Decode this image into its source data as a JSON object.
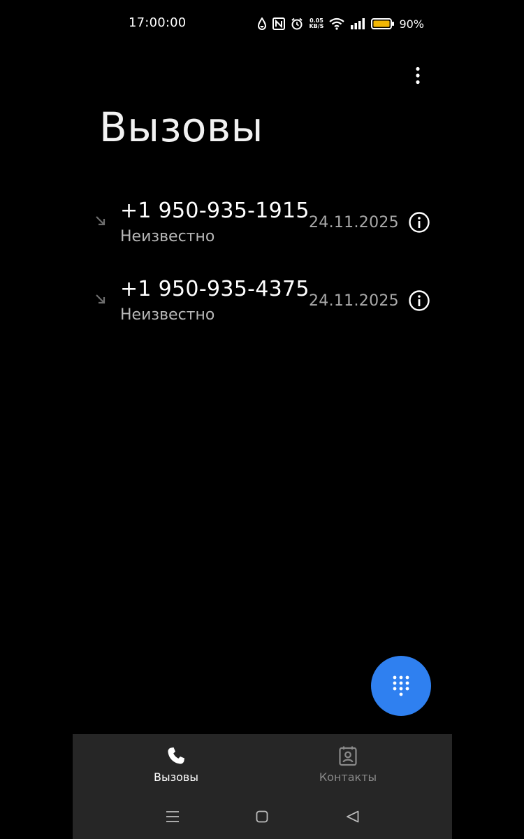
{
  "status_bar": {
    "time": "17:00:00",
    "net_speed_value": "0.05",
    "net_speed_unit": "KB/S",
    "battery_percent": "90%",
    "icons": [
      "drop-icon",
      "nfc-icon",
      "alarm-icon",
      "wifi-icon",
      "signal-icon",
      "battery-icon"
    ]
  },
  "header": {
    "title": "Вызовы",
    "menu_icon": "more-vert-icon"
  },
  "calls": [
    {
      "number": "+1 950-935-1915",
      "label": "Неизвестно",
      "date": "24.11.2025",
      "type_icon": "incoming-call-arrow-icon"
    },
    {
      "number": "+1 950-935-4375",
      "label": "Неизвестно",
      "date": "24.11.2025",
      "type_icon": "incoming-call-arrow-icon"
    }
  ],
  "fab": {
    "icon": "dialpad-icon",
    "color": "#2f80f0"
  },
  "bottom_nav": {
    "tabs": [
      {
        "label": "Вызовы",
        "icon": "phone-icon",
        "active": true
      },
      {
        "label": "Контакты",
        "icon": "contacts-icon",
        "active": false
      }
    ]
  },
  "system_nav": {
    "buttons": [
      "menu-icon",
      "home-icon",
      "back-icon"
    ]
  },
  "colors": {
    "background": "#000000",
    "nav_background": "#262626",
    "accent": "#2f80f0",
    "secondary_text": "#b8b8b8"
  }
}
